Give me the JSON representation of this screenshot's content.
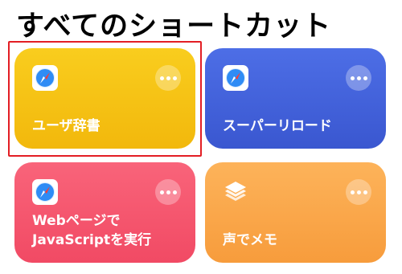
{
  "header": {
    "title": "すべてのショートカット"
  },
  "cards": [
    {
      "label": "ユーザ辞書",
      "icon": "safari-compass-icon",
      "color": "#f5c514"
    },
    {
      "label": "スーパーリロード",
      "icon": "safari-compass-icon",
      "color": "#4262dc"
    },
    {
      "label_lines": [
        "Webページで",
        "JavaScriptを実行"
      ],
      "icon": "safari-compass-icon",
      "color": "#f4566e"
    },
    {
      "label": "声でメモ",
      "icon": "layers-icon",
      "color": "#fba84a"
    }
  ],
  "colors": {
    "selection": "#e31e24"
  }
}
